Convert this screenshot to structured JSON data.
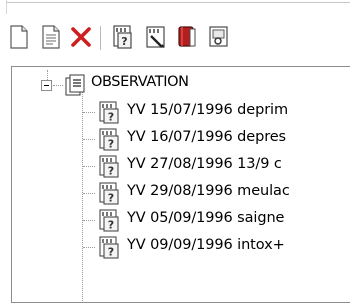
{
  "toolbar": {
    "buttons": [
      {
        "icon": "new-document-icon"
      },
      {
        "icon": "document-icon"
      },
      {
        "icon": "delete-icon",
        "color": "#cc1f1f"
      },
      {
        "icon": "question-document-icon"
      },
      {
        "icon": "edit-document-icon"
      },
      {
        "icon": "red-book-icon",
        "color": "#b51e1e"
      },
      {
        "icon": "print-preview-icon"
      }
    ]
  },
  "tree": {
    "root": {
      "label": "OBSERVATION",
      "icon": "folder-document-icon",
      "expanded": true
    },
    "items": [
      {
        "label": "YV 15/07/1996 deprim",
        "icon": "question-document-icon"
      },
      {
        "label": "YV 16/07/1996 depres",
        "icon": "question-document-icon"
      },
      {
        "label": "YV 27/08/1996 13/9 c",
        "icon": "question-document-icon"
      },
      {
        "label": "YV 29/08/1996 meulac",
        "icon": "question-document-icon"
      },
      {
        "label": "YV 05/09/1996 saigne",
        "icon": "question-document-icon"
      },
      {
        "label": "YV 09/09/1996 intox+",
        "icon": "question-document-icon"
      }
    ]
  }
}
